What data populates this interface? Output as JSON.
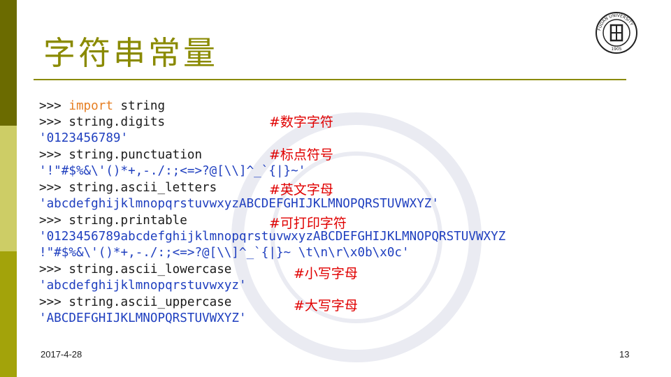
{
  "slide": {
    "title": "字符串常量",
    "date": "2017-4-28",
    "page_number": "13"
  },
  "logo": {
    "text": "FUDAN UNIVERSITY",
    "year": "1905"
  },
  "code": {
    "l1_prompt": ">>> ",
    "l1_kw": "import",
    "l1_rest": " string",
    "l2": ">>> string.digits",
    "l3": "'0123456789'",
    "l4": ">>> string.punctuation",
    "l5": "'!\"#$%&\\'()*+,-./:;<=>?@[\\\\]^_`{|}~'",
    "l6": ">>> string.ascii_letters",
    "l7": "'abcdefghijklmnopqrstuvwxyzABCDEFGHIJKLMNOPQRSTUVWXYZ'",
    "l8": ">>> string.printable",
    "l9": "'0123456789abcdefghijklmnopqrstuvwxyzABCDEFGHIJKLMNOPQRSTUVWXYZ",
    "l10": "!\"#$%&\\'()*+,-./:;<=>?@[\\\\]^_`{|}~ \\t\\n\\r\\x0b\\x0c'",
    "l11": ">>> string.ascii_lowercase",
    "l12": "'abcdefghijklmnopqrstuvwxyz'",
    "l13": ">>> string.ascii_uppercase",
    "l14": "'ABCDEFGHIJKLMNOPQRSTUVWXYZ'"
  },
  "comments": {
    "digits": "#数字字符",
    "punctuation": "#标点符号",
    "letters": "#英文字母",
    "printable": "#可打印字符",
    "lowercase": "#小写字母",
    "uppercase": "#大写字母"
  }
}
